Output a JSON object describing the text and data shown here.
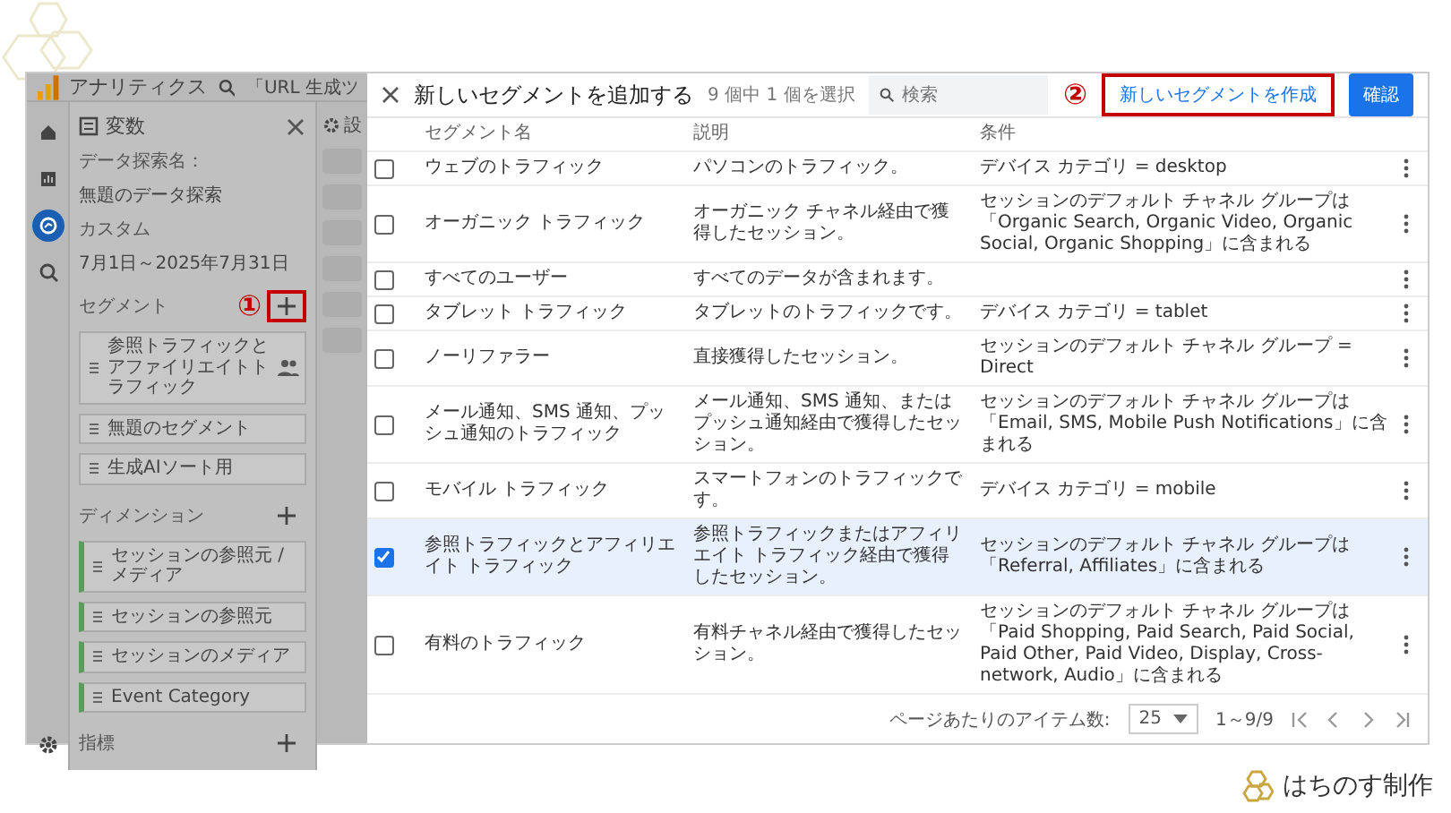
{
  "app": {
    "title": "アナリティクス",
    "search_text": "「URL 生成ツ",
    "nav": [
      {
        "kind": "home",
        "selected": false
      },
      {
        "kind": "reports",
        "selected": false
      },
      {
        "kind": "explore",
        "selected": true
      },
      {
        "kind": "advertising",
        "selected": false
      }
    ],
    "variables": {
      "title": "変数",
      "name_label": "データ探索名：",
      "name_value": "無題のデータ探索",
      "date_label": "カスタム",
      "date_value": "7月1日～2025年7月31日",
      "sections": [
        {
          "kind": "segment",
          "title": "セグメント",
          "annotation": "①",
          "items": [
            {
              "label": "参照トラフィックとアファイリエイトトラフィック",
              "shared": true
            },
            {
              "label": "無題のセグメント",
              "shared": false
            },
            {
              "label": "生成AIソート用",
              "shared": false
            }
          ]
        },
        {
          "kind": "dimension",
          "title": "ディメンション",
          "items": [
            {
              "label": "セッションの参照元 / メディア",
              "shared": false
            },
            {
              "label": "セッションの参照元",
              "shared": false
            },
            {
              "label": "セッションのメディア",
              "shared": false
            },
            {
              "label": "Event Category",
              "shared": false
            }
          ]
        },
        {
          "kind": "metric",
          "title": "指標"
        }
      ]
    },
    "settings_tab": "設"
  },
  "dialog": {
    "title": "新しいセグメントを追加する",
    "subtitle": "9 個中 1 個を選択",
    "search_placeholder": "検索",
    "create_button": {
      "label": "新しいセグメントを作成",
      "annotation": "②"
    },
    "confirm_button": "確認",
    "columns": [
      "セグメント名",
      "説明",
      "条件"
    ],
    "rows": [
      {
        "name": "ウェブのトラフィック",
        "description": "パソコンのトラフィック。",
        "condition": "デバイス カテゴリ = desktop",
        "checked": false
      },
      {
        "name": "オーガニック トラフィック",
        "description": "オーガニック チャネル経由で獲得したセッション。",
        "condition": "セッションのデフォルト チャネル グループは「Organic Search, Organic Video, Organic Social, Organic Shopping」に含まれる",
        "checked": false
      },
      {
        "name": "すべてのユーザー",
        "description": "すべてのデータが含まれます。",
        "condition": "",
        "checked": false
      },
      {
        "name": "タブレット トラフィック",
        "description": "タブレットのトラフィックです。",
        "condition": "デバイス カテゴリ = tablet",
        "checked": false
      },
      {
        "name": "ノーリファラー",
        "description": "直接獲得したセッション。",
        "condition": "セッションのデフォルト チャネル グループ = Direct",
        "checked": false
      },
      {
        "name": "メール通知、SMS 通知、プッシュ通知のトラフィック",
        "description": "メール通知、SMS 通知、またはプッシュ通知経由で獲得したセッション。",
        "condition": "セッションのデフォルト チャネル グループは「Email, SMS, Mobile Push Notifications」に含まれる",
        "checked": false
      },
      {
        "name": "モバイル トラフィック",
        "description": "スマートフォンのトラフィックです。",
        "condition": "デバイス カテゴリ = mobile",
        "checked": false
      },
      {
        "name": "参照トラフィックとアフィリエイト トラフィック",
        "description": "参照トラフィックまたはアフィリエイト トラフィック経由で獲得したセッション。",
        "condition": "セッションのデフォルト チャネル グループは「Referral, Affiliates」に含まれる",
        "checked": true
      },
      {
        "name": "有料のトラフィック",
        "description": "有料チャネル経由で獲得したセッション。",
        "condition": "セッションのデフォルト チャネル グループは「Paid Shopping, Paid Search, Paid Social, Paid Other, Paid Video, Display, Cross-network, Audio」に含まれる",
        "checked": false
      }
    ],
    "pagination": {
      "per_page_label": "ページあたりのアイテム数:",
      "per_page": "25",
      "range": "1～9/9"
    }
  },
  "brand": "はちのす制作"
}
